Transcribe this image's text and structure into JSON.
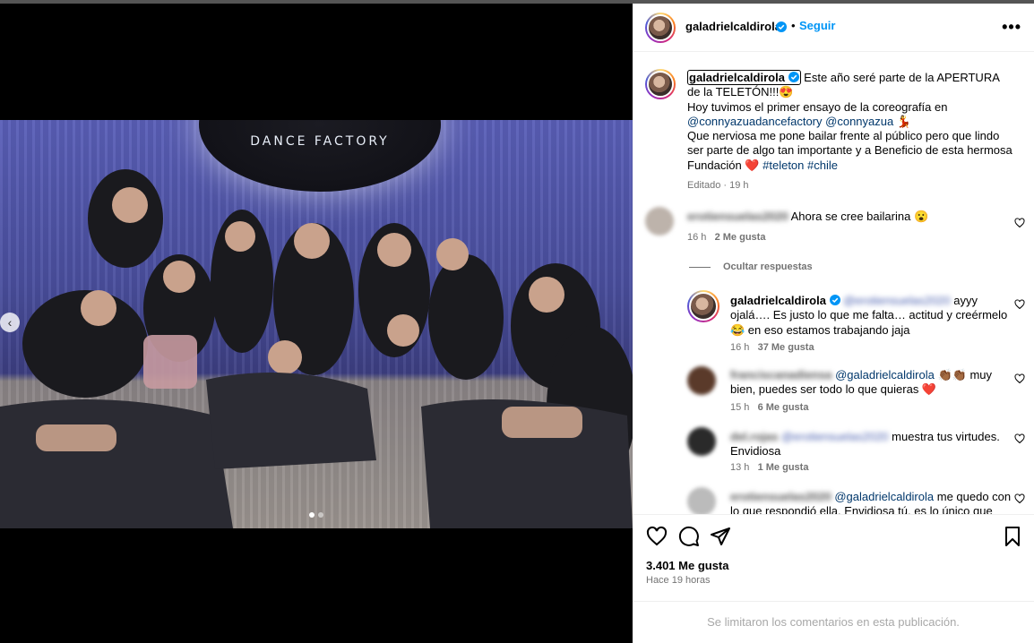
{
  "post": {
    "sign_text": "DANCE FACTORY",
    "carousel_dots": 2
  },
  "header": {
    "username": "galadrielcaldirola",
    "separator": "•",
    "follow": "Seguir",
    "more": "•••"
  },
  "caption": {
    "username": "galadrielcaldirola",
    "line1": " Este año seré parte de la APERTURA de la TELETÓN!!!😍",
    "line2": "Hoy tuvimos el primer ensayo de la coreografía en",
    "mention1": "@connyazuadancefactory",
    "mention2": "@connyazua",
    "emoji1": " 💃",
    "line3": "Que nerviosa me pone bailar frente al público pero que lindo ser parte de algo tan importante y a Beneficio de esta hermosa Fundación ❤️ ",
    "hashtag1": "#teleton",
    "hashtag2": "#chile",
    "meta": "Editado · 19 h"
  },
  "comments": [
    {
      "username": "erotiensuelas2020",
      "text": "Ahora se cree bailarina 😮",
      "time": "16 h",
      "likes": "2 Me gusta"
    },
    {
      "hide_replies": "Ocultar respuestas"
    },
    {
      "username": "galadrielcaldirola",
      "mention": "@erotiensuelas2020",
      "text": " ayyy ojalá…. Es justo lo que me falta… actitud y creérmelo 😂 en eso estamos trabajando jaja",
      "time": "16 h",
      "likes": "37 Me gusta"
    },
    {
      "username": "franciscanadiensa",
      "mention": "@galadrielcaldirola",
      "text": " 👏🏾👏🏾 muy bien, puedes ser todo lo que quieras ❤️",
      "time": "15 h",
      "likes": "6 Me gusta"
    },
    {
      "username": "del.rojas",
      "mention": "@erotiensuelas2020",
      "text": " muestra tus virtudes. Envidiosa",
      "time": "13 h",
      "likes": "1 Me gusta"
    },
    {
      "username": "erotiensuelas2020",
      "mention": "@galadrielcaldirola",
      "text": " me quedo con lo que respondió ella. Envidiosa tú, es lo único que"
    }
  ],
  "actions": {
    "likes": "3.401 Me gusta",
    "time": "Hace 19 horas"
  },
  "footer": {
    "text": "Se limitaron los comentarios en esta publicación."
  }
}
